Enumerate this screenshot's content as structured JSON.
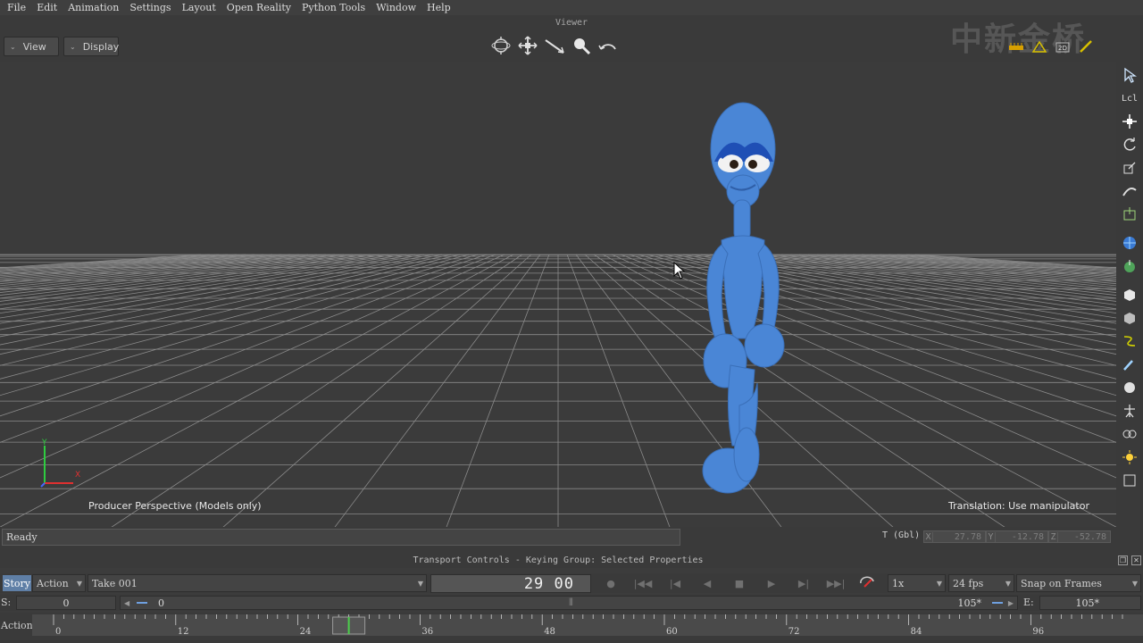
{
  "menu": [
    "File",
    "Edit",
    "Animation",
    "Settings",
    "Layout",
    "Open Reality",
    "Python Tools",
    "Window",
    "Help"
  ],
  "viewer": {
    "title": "Viewer",
    "view_button": "View",
    "display_button": "Display",
    "camera_label": "Producer Perspective (Models only)",
    "manipulator_label": "Translation: Use manipulator",
    "axis_y": "Y",
    "axis_x": "X"
  },
  "watermark": "中新金桥",
  "status": {
    "text": "Ready",
    "coord_label": "T (Gbl)",
    "x_axis": "X",
    "x": "27.78",
    "y_axis": "Y",
    "y": "-12.78",
    "z_axis": "Z",
    "z": "-52.78"
  },
  "transport": {
    "title": "Transport Controls  -  Keying Group: Selected Properties",
    "story_tab": "Story",
    "action_dropdown": "Action",
    "take_dropdown": "Take 001",
    "frame_display": "29 00",
    "speed": "1x",
    "fps": "24 fps",
    "snap": "Snap on Frames"
  },
  "range": {
    "start_label": "S:",
    "start_value": "0",
    "zoom_start": "0",
    "zoom_end": "105*",
    "end_label": "E:",
    "end_value": "105*"
  },
  "timeline": {
    "label": "Action",
    "ticks": [
      "0",
      "12",
      "24",
      "36",
      "48",
      "60",
      "72",
      "84",
      "96"
    ],
    "current_frame": 29
  }
}
